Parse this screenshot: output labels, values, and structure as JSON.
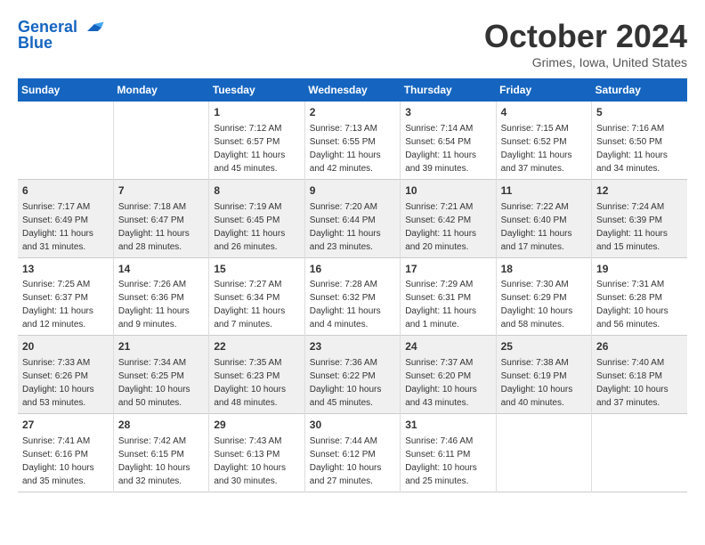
{
  "header": {
    "logo_line1": "General",
    "logo_line2": "Blue",
    "month": "October 2024",
    "location": "Grimes, Iowa, United States"
  },
  "weekdays": [
    "Sunday",
    "Monday",
    "Tuesday",
    "Wednesday",
    "Thursday",
    "Friday",
    "Saturday"
  ],
  "weeks": [
    [
      {
        "day": "",
        "info": ""
      },
      {
        "day": "",
        "info": ""
      },
      {
        "day": "1",
        "info": "Sunrise: 7:12 AM\nSunset: 6:57 PM\nDaylight: 11 hours and 45 minutes."
      },
      {
        "day": "2",
        "info": "Sunrise: 7:13 AM\nSunset: 6:55 PM\nDaylight: 11 hours and 42 minutes."
      },
      {
        "day": "3",
        "info": "Sunrise: 7:14 AM\nSunset: 6:54 PM\nDaylight: 11 hours and 39 minutes."
      },
      {
        "day": "4",
        "info": "Sunrise: 7:15 AM\nSunset: 6:52 PM\nDaylight: 11 hours and 37 minutes."
      },
      {
        "day": "5",
        "info": "Sunrise: 7:16 AM\nSunset: 6:50 PM\nDaylight: 11 hours and 34 minutes."
      }
    ],
    [
      {
        "day": "6",
        "info": "Sunrise: 7:17 AM\nSunset: 6:49 PM\nDaylight: 11 hours and 31 minutes."
      },
      {
        "day": "7",
        "info": "Sunrise: 7:18 AM\nSunset: 6:47 PM\nDaylight: 11 hours and 28 minutes."
      },
      {
        "day": "8",
        "info": "Sunrise: 7:19 AM\nSunset: 6:45 PM\nDaylight: 11 hours and 26 minutes."
      },
      {
        "day": "9",
        "info": "Sunrise: 7:20 AM\nSunset: 6:44 PM\nDaylight: 11 hours and 23 minutes."
      },
      {
        "day": "10",
        "info": "Sunrise: 7:21 AM\nSunset: 6:42 PM\nDaylight: 11 hours and 20 minutes."
      },
      {
        "day": "11",
        "info": "Sunrise: 7:22 AM\nSunset: 6:40 PM\nDaylight: 11 hours and 17 minutes."
      },
      {
        "day": "12",
        "info": "Sunrise: 7:24 AM\nSunset: 6:39 PM\nDaylight: 11 hours and 15 minutes."
      }
    ],
    [
      {
        "day": "13",
        "info": "Sunrise: 7:25 AM\nSunset: 6:37 PM\nDaylight: 11 hours and 12 minutes."
      },
      {
        "day": "14",
        "info": "Sunrise: 7:26 AM\nSunset: 6:36 PM\nDaylight: 11 hours and 9 minutes."
      },
      {
        "day": "15",
        "info": "Sunrise: 7:27 AM\nSunset: 6:34 PM\nDaylight: 11 hours and 7 minutes."
      },
      {
        "day": "16",
        "info": "Sunrise: 7:28 AM\nSunset: 6:32 PM\nDaylight: 11 hours and 4 minutes."
      },
      {
        "day": "17",
        "info": "Sunrise: 7:29 AM\nSunset: 6:31 PM\nDaylight: 11 hours and 1 minute."
      },
      {
        "day": "18",
        "info": "Sunrise: 7:30 AM\nSunset: 6:29 PM\nDaylight: 10 hours and 58 minutes."
      },
      {
        "day": "19",
        "info": "Sunrise: 7:31 AM\nSunset: 6:28 PM\nDaylight: 10 hours and 56 minutes."
      }
    ],
    [
      {
        "day": "20",
        "info": "Sunrise: 7:33 AM\nSunset: 6:26 PM\nDaylight: 10 hours and 53 minutes."
      },
      {
        "day": "21",
        "info": "Sunrise: 7:34 AM\nSunset: 6:25 PM\nDaylight: 10 hours and 50 minutes."
      },
      {
        "day": "22",
        "info": "Sunrise: 7:35 AM\nSunset: 6:23 PM\nDaylight: 10 hours and 48 minutes."
      },
      {
        "day": "23",
        "info": "Sunrise: 7:36 AM\nSunset: 6:22 PM\nDaylight: 10 hours and 45 minutes."
      },
      {
        "day": "24",
        "info": "Sunrise: 7:37 AM\nSunset: 6:20 PM\nDaylight: 10 hours and 43 minutes."
      },
      {
        "day": "25",
        "info": "Sunrise: 7:38 AM\nSunset: 6:19 PM\nDaylight: 10 hours and 40 minutes."
      },
      {
        "day": "26",
        "info": "Sunrise: 7:40 AM\nSunset: 6:18 PM\nDaylight: 10 hours and 37 minutes."
      }
    ],
    [
      {
        "day": "27",
        "info": "Sunrise: 7:41 AM\nSunset: 6:16 PM\nDaylight: 10 hours and 35 minutes."
      },
      {
        "day": "28",
        "info": "Sunrise: 7:42 AM\nSunset: 6:15 PM\nDaylight: 10 hours and 32 minutes."
      },
      {
        "day": "29",
        "info": "Sunrise: 7:43 AM\nSunset: 6:13 PM\nDaylight: 10 hours and 30 minutes."
      },
      {
        "day": "30",
        "info": "Sunrise: 7:44 AM\nSunset: 6:12 PM\nDaylight: 10 hours and 27 minutes."
      },
      {
        "day": "31",
        "info": "Sunrise: 7:46 AM\nSunset: 6:11 PM\nDaylight: 10 hours and 25 minutes."
      },
      {
        "day": "",
        "info": ""
      },
      {
        "day": "",
        "info": ""
      }
    ]
  ]
}
